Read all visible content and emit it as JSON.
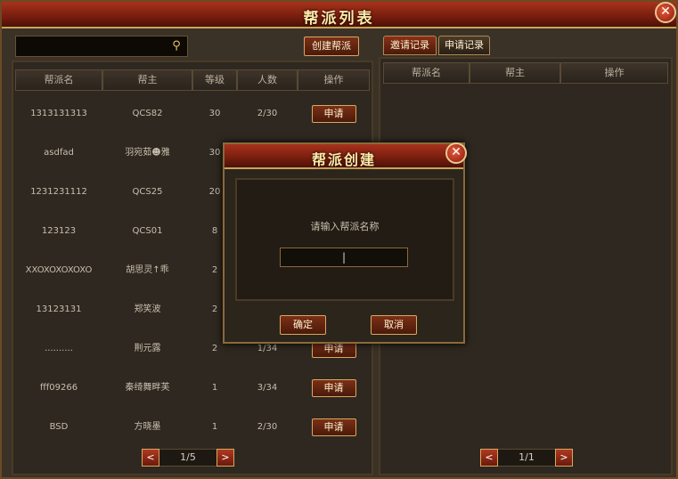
{
  "window": {
    "title": "帮派列表",
    "close_glyph": "✕"
  },
  "left": {
    "search": {
      "value": "",
      "icon": "search-icon"
    },
    "create_button": "创建帮派",
    "columns": [
      "帮派名",
      "帮主",
      "等级",
      "人数",
      "操作"
    ],
    "rows": [
      {
        "name": "1313131313",
        "leader": "QCS82",
        "level": "30",
        "members": "2/30",
        "action": "申请"
      },
      {
        "name": "asdfad",
        "leader": "羽宛茹☻雅",
        "level": "30",
        "members": "",
        "action": ""
      },
      {
        "name": "1231231112",
        "leader": "QCS25",
        "level": "20",
        "members": "",
        "action": ""
      },
      {
        "name": "123123",
        "leader": "QCS01",
        "level": "8",
        "members": "",
        "action": ""
      },
      {
        "name": "XXOXOXOXOXO",
        "leader": "胡思灵↑乖",
        "level": "2",
        "members": "",
        "action": ""
      },
      {
        "name": "13123131",
        "leader": "郑笑波",
        "level": "2",
        "members": "",
        "action": ""
      },
      {
        "name": "..........",
        "leader": "荆元露",
        "level": "2",
        "members": "1/34",
        "action": "申请"
      },
      {
        "name": "fff09266",
        "leader": "秦绮舞畔芙",
        "level": "1",
        "members": "3/34",
        "action": "申请"
      },
      {
        "name": "BSD",
        "leader": "方晓墨",
        "level": "1",
        "members": "2/30",
        "action": "申请"
      }
    ],
    "pager": {
      "prev": "<",
      "text": "1/5",
      "next": ">"
    }
  },
  "right": {
    "tabs": [
      "邀请记录",
      "申请记录"
    ],
    "columns": [
      "帮派名",
      "帮主",
      "操作"
    ],
    "pager": {
      "prev": "<",
      "text": "1/1",
      "next": ">"
    }
  },
  "dialog": {
    "title": "帮派创建",
    "close_glyph": "✕",
    "prompt": "请输入帮派名称",
    "input_value": "|",
    "confirm": "确定",
    "cancel": "取消"
  }
}
